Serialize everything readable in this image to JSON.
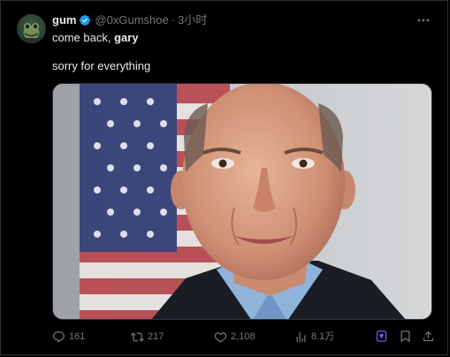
{
  "tweet": {
    "author": {
      "display_name": "gum",
      "handle": "@0xGumshoe",
      "verified": true,
      "avatar_icon": "frog-avatar-icon"
    },
    "separator": "·",
    "timestamp": "3小时",
    "text": {
      "line1_prefix": "come back, ",
      "line1_bold": "gary",
      "line2": "sorry for everything"
    },
    "media": {
      "type": "photo",
      "icon": "portrait-photo"
    },
    "actions": {
      "replies": "161",
      "retweets": "217",
      "likes": "2,108",
      "views": "8.1万"
    },
    "colors": {
      "background": "#000000",
      "text": "#e7e9ea",
      "secondary": "#71767b",
      "verified": "#1d9bf0",
      "grok": "#7856ff",
      "border": "#2f3336"
    }
  }
}
